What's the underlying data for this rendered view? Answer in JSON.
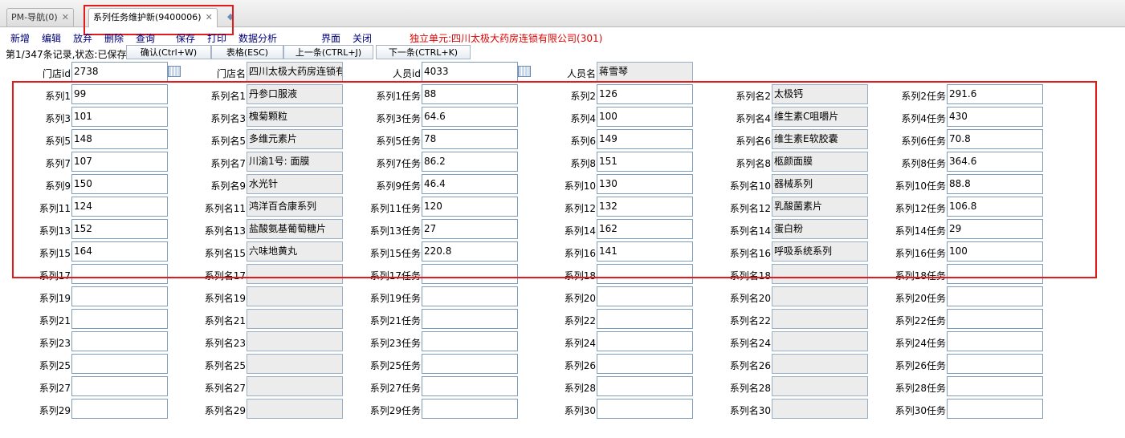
{
  "tabs": [
    {
      "label": "PM-导航(0)",
      "active": false
    },
    {
      "label": "系列任务维护新(9400006)",
      "active": true
    }
  ],
  "toolbar": {
    "items": [
      "新增",
      "编辑",
      "放弃",
      "删除",
      "查询",
      "保存",
      "打印",
      "数据分析",
      "界面",
      "关闭"
    ],
    "unit_label": "独立单元:四川太极大药房连锁有限公司(301)"
  },
  "status": {
    "text": "第1/347条记录,状态:已保存",
    "buttons": [
      "确认(Ctrl+W)",
      "表格(ESC)",
      "上一条(CTRL+J)",
      "下一条(CTRL+K)"
    ]
  },
  "header_fields": {
    "store_id_label": "门店id",
    "store_id": "2738",
    "store_name_label": "门店名",
    "store_name": "四川太极大药房连锁有",
    "person_id_label": "人员id",
    "person_id": "4033",
    "person_name_label": "人员名",
    "person_name": "蒋雪琴"
  },
  "rows": [
    {
      "l1": "系列1",
      "v1": "99",
      "l2": "系列名1",
      "v2": "丹参口服液",
      "l3": "系列1任务",
      "v3": "88",
      "l4": "系列2",
      "v4": "126",
      "l5": "系列名2",
      "v5": "太极钙",
      "l6": "系列2任务",
      "v6": "291.6"
    },
    {
      "l1": "系列3",
      "v1": "101",
      "l2": "系列名3",
      "v2": "槐菊颗粒",
      "l3": "系列3任务",
      "v3": "64.6",
      "l4": "系列4",
      "v4": "100",
      "l5": "系列名4",
      "v5": "维生素C咀嚼片",
      "l6": "系列4任务",
      "v6": "430"
    },
    {
      "l1": "系列5",
      "v1": "148",
      "l2": "系列名5",
      "v2": "多维元素片",
      "l3": "系列5任务",
      "v3": "78",
      "l4": "系列6",
      "v4": "149",
      "l5": "系列名6",
      "v5": "维生素E软胶囊",
      "l6": "系列6任务",
      "v6": "70.8"
    },
    {
      "l1": "系列7",
      "v1": "107",
      "l2": "系列名7",
      "v2": "川渝1号: 面膜",
      "l3": "系列7任务",
      "v3": "86.2",
      "l4": "系列8",
      "v4": "151",
      "l5": "系列名8",
      "v5": "柩颜面膜",
      "l6": "系列8任务",
      "v6": "364.6"
    },
    {
      "l1": "系列9",
      "v1": "150",
      "l2": "系列名9",
      "v2": "水光针",
      "l3": "系列9任务",
      "v3": "46.4",
      "l4": "系列10",
      "v4": "130",
      "l5": "系列名10",
      "v5": "器械系列",
      "l6": "系列10任务",
      "v6": "88.8"
    },
    {
      "l1": "系列11",
      "v1": "124",
      "l2": "系列名11",
      "v2": "鸿洋百合康系列",
      "l3": "系列11任务",
      "v3": "120",
      "l4": "系列12",
      "v4": "132",
      "l5": "系列名12",
      "v5": "乳酸菌素片",
      "l6": "系列12任务",
      "v6": "106.8"
    },
    {
      "l1": "系列13",
      "v1": "152",
      "l2": "系列名13",
      "v2": "盐酸氨基葡萄糖片",
      "l3": "系列13任务",
      "v3": "27",
      "l4": "系列14",
      "v4": "162",
      "l5": "系列名14",
      "v5": "蛋白粉",
      "l6": "系列14任务",
      "v6": "29"
    },
    {
      "l1": "系列15",
      "v1": "164",
      "l2": "系列名15",
      "v2": "六味地黄丸",
      "l3": "系列15任务",
      "v3": "220.8",
      "l4": "系列16",
      "v4": "141",
      "l5": "系列名16",
      "v5": "呼吸系统系列",
      "l6": "系列16任务",
      "v6": "100"
    },
    {
      "l1": "系列17",
      "v1": "",
      "l2": "系列名17",
      "v2": "",
      "l3": "系列17任务",
      "v3": "",
      "l4": "系列18",
      "v4": "",
      "l5": "系列名18",
      "v5": "",
      "l6": "系列18任务",
      "v6": ""
    },
    {
      "l1": "系列19",
      "v1": "",
      "l2": "系列名19",
      "v2": "",
      "l3": "系列19任务",
      "v3": "",
      "l4": "系列20",
      "v4": "",
      "l5": "系列名20",
      "v5": "",
      "l6": "系列20任务",
      "v6": ""
    },
    {
      "l1": "系列21",
      "v1": "",
      "l2": "系列名21",
      "v2": "",
      "l3": "系列21任务",
      "v3": "",
      "l4": "系列22",
      "v4": "",
      "l5": "系列名22",
      "v5": "",
      "l6": "系列22任务",
      "v6": ""
    },
    {
      "l1": "系列23",
      "v1": "",
      "l2": "系列名23",
      "v2": "",
      "l3": "系列23任务",
      "v3": "",
      "l4": "系列24",
      "v4": "",
      "l5": "系列名24",
      "v5": "",
      "l6": "系列24任务",
      "v6": ""
    },
    {
      "l1": "系列25",
      "v1": "",
      "l2": "系列名25",
      "v2": "",
      "l3": "系列25任务",
      "v3": "",
      "l4": "系列26",
      "v4": "",
      "l5": "系列名26",
      "v5": "",
      "l6": "系列26任务",
      "v6": ""
    },
    {
      "l1": "系列27",
      "v1": "",
      "l2": "系列名27",
      "v2": "",
      "l3": "系列27任务",
      "v3": "",
      "l4": "系列28",
      "v4": "",
      "l5": "系列名28",
      "v5": "",
      "l6": "系列28任务",
      "v6": ""
    },
    {
      "l1": "系列29",
      "v1": "",
      "l2": "系列名29",
      "v2": "",
      "l3": "系列29任务",
      "v3": "",
      "l4": "系列30",
      "v4": "",
      "l5": "系列名30",
      "v5": "",
      "l6": "系列30任务",
      "v6": ""
    }
  ],
  "colors": {
    "unit_label": "#e00000",
    "annotation": "#e11b1b",
    "toolbar_text": "#00007a"
  }
}
